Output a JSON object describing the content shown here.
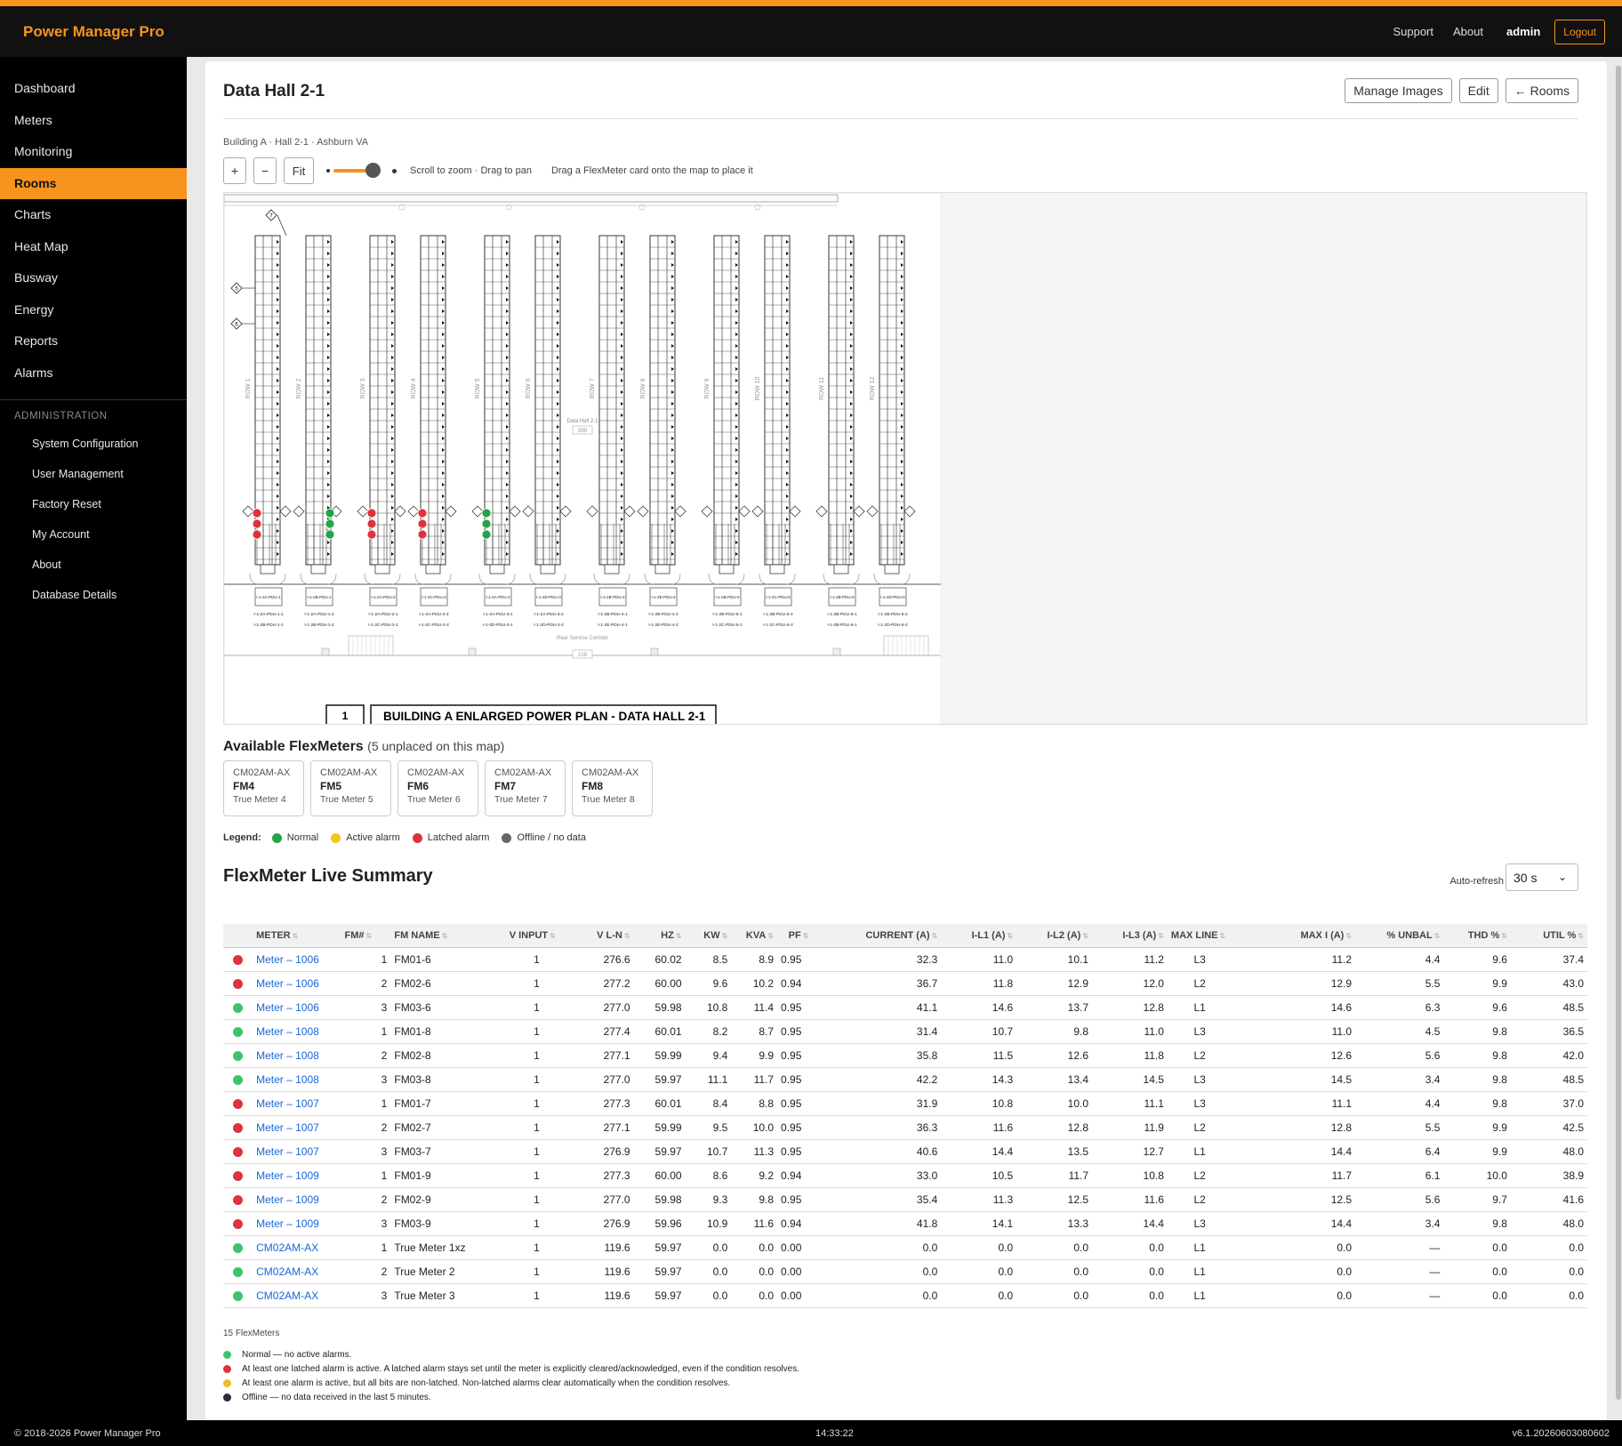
{
  "app": {
    "title": "Power Manager Pro"
  },
  "topbar": {
    "support": "Support",
    "about": "About",
    "user": "admin",
    "logout": "Logout"
  },
  "sidebar": {
    "items": [
      {
        "label": "Dashboard"
      },
      {
        "label": "Meters"
      },
      {
        "label": "Monitoring"
      },
      {
        "label": "Rooms",
        "active": true
      },
      {
        "label": "Charts"
      },
      {
        "label": "Heat Map"
      },
      {
        "label": "Busway"
      },
      {
        "label": "Energy"
      },
      {
        "label": "Reports"
      },
      {
        "label": "Alarms"
      }
    ],
    "admin_header": "ADMINISTRATION",
    "admin_items": [
      {
        "label": "System Configuration"
      },
      {
        "label": "User Management"
      },
      {
        "label": "Factory Reset"
      },
      {
        "label": "My Account"
      },
      {
        "label": "About"
      },
      {
        "label": "Database Details"
      }
    ]
  },
  "page": {
    "title": "Data Hall 2-1",
    "buttons": {
      "manage_images": "Manage Images",
      "edit": "Edit",
      "rooms": "← Rooms"
    },
    "subtitle": "Building A · Hall 2-1 · Ashburn VA",
    "toolbar": {
      "zoom_in": "+",
      "zoom_out": "−",
      "fit": "Fit",
      "zoom_level": 0.8,
      "hint1": "Scroll to zoom · Drag to pan",
      "hint2": "Drag a FlexMeter card onto the map to place it"
    }
  },
  "floorplan": {
    "title_number": "1",
    "title": "BUILDING A ENLARGED POWER PLAN - DATA HALL 2-1",
    "room_label": "Data Hall 2-1",
    "room_number": "200",
    "corridor_label": "Rear Service Corridor",
    "corridor_number": "219",
    "rows": [
      "ROW 1",
      "ROW 2",
      "ROW 3",
      "ROW 4",
      "ROW 5",
      "ROW 6",
      "ROW 7",
      "ROW 8",
      "ROW 9",
      "ROW 10",
      "ROW 11",
      "ROW 12"
    ],
    "pdus": [
      {
        "label": "I-1-2A-PDU-1",
        "feed_a": "I-1-2A-PDU-1-1",
        "feed_b": "I-1-2B-PDU-1-1"
      },
      {
        "label": "I-1-2B-PDU-1",
        "feed_a": "I-1-2A-PDU-1-2",
        "feed_b": "I-1-2B-PDU-1-2"
      },
      {
        "label": "I-1-2A-PDU-2",
        "feed_a": "I-1-2A-PDU-2-1",
        "feed_b": "I-1-2C-PDU-2-1"
      },
      {
        "label": "I-1-2C-PDU-2",
        "feed_a": "I-1-2A-PDU-2-2",
        "feed_b": "I-1-2C-PDU-2-2"
      },
      {
        "label": "I-1-2A-PDU-3",
        "feed_a": "I-1-2A-PDU-3-1",
        "feed_b": "I-1-2D-PDU-3-1"
      },
      {
        "label": "I-1-2D-PDU-3",
        "feed_a": "I-1-2A-PDU-3-2",
        "feed_b": "I-1-2D-PDU-3-2"
      },
      {
        "label": "I-1-2B-PDU-4",
        "feed_a": "I-1-2B-PDU-4-1",
        "feed_b": "I-1-2E-PDU-4-1"
      },
      {
        "label": "I-1-2E-PDU-4",
        "feed_a": "I-1-2B-PDU-4-2",
        "feed_b": "I-1-2E-PDU-4-2"
      },
      {
        "label": "I-1-2B-PDU-5",
        "feed_a": "I-1-2B-PDU-5-1",
        "feed_b": "I-1-2C-PDU-5-1"
      },
      {
        "label": "I-1-2C-PDU-5",
        "feed_a": "I-1-2B-PDU-5-2",
        "feed_b": "I-1-2C-PDU-5-2"
      },
      {
        "label": "I-1-2B-PDU-6",
        "feed_a": "I-1-2B-PDU-6-1",
        "feed_b": "I-1-2B-PDU-6-1"
      },
      {
        "label": "I-1-2D-PDU-6",
        "feed_a": "I-1-2B-PDU-6-2",
        "feed_b": "I-1-2D-PDU-6-2"
      }
    ],
    "placed_meters": [
      {
        "status": "alarm"
      },
      {
        "status": "normal"
      },
      {
        "status": "alarm"
      },
      {
        "status": "alarm"
      },
      {
        "status": "normal"
      }
    ]
  },
  "available": {
    "title": "Available FlexMeters",
    "note": "(5 unplaced on this map)",
    "cards": [
      {
        "model": "CM02AM-AX",
        "name": "FM4",
        "desc": "True Meter 4"
      },
      {
        "model": "CM02AM-AX",
        "name": "FM5",
        "desc": "True Meter 5"
      },
      {
        "model": "CM02AM-AX",
        "name": "FM6",
        "desc": "True Meter 6"
      },
      {
        "model": "CM02AM-AX",
        "name": "FM7",
        "desc": "True Meter 7"
      },
      {
        "model": "CM02AM-AX",
        "name": "FM8",
        "desc": "True Meter 8"
      }
    ]
  },
  "legend": {
    "label": "Legend:",
    "items": [
      {
        "label": "Normal",
        "color": "#22a447"
      },
      {
        "label": "Active alarm",
        "color": "#f5c518"
      },
      {
        "label": "Latched alarm",
        "color": "#e0323c"
      },
      {
        "label": "Offline / no data",
        "color": "#666666"
      }
    ]
  },
  "summary": {
    "title": "FlexMeter Live Summary",
    "autorefresh_label": "Auto-refresh",
    "autorefresh_value": "30 s",
    "columns": [
      "METER",
      "FM#",
      "FM NAME",
      "V INPUT",
      "V L-N",
      "HZ",
      "KW",
      "KVA",
      "PF",
      "CURRENT (A)",
      "I-L1 (A)",
      "I-L2 (A)",
      "I-L3 (A)",
      "MAX LINE",
      "MAX I (A)",
      "% UNBAL",
      "THD %",
      "UTIL %"
    ],
    "rows": [
      {
        "status": "red",
        "meter": "Meter – 1006",
        "fm": "1",
        "name": "FM01-6",
        "vin": "1",
        "vln": "276.6",
        "hz": "60.02",
        "kw": "8.5",
        "kva": "8.9",
        "pf": "0.95",
        "cur": "32.3",
        "l1": "11.0",
        "l2": "10.1",
        "l3": "11.2",
        "maxline": "L3",
        "maxi": "11.2",
        "unbal": "4.4",
        "thd": "9.6",
        "util": "37.4"
      },
      {
        "status": "red",
        "meter": "Meter – 1006",
        "fm": "2",
        "name": "FM02-6",
        "vin": "1",
        "vln": "277.2",
        "hz": "60.00",
        "kw": "9.6",
        "kva": "10.2",
        "pf": "0.94",
        "cur": "36.7",
        "l1": "11.8",
        "l2": "12.9",
        "l3": "12.0",
        "maxline": "L2",
        "maxi": "12.9",
        "unbal": "5.5",
        "thd": "9.9",
        "util": "43.0"
      },
      {
        "status": "green",
        "meter": "Meter – 1006",
        "fm": "3",
        "name": "FM03-6",
        "vin": "1",
        "vln": "277.0",
        "hz": "59.98",
        "kw": "10.8",
        "kva": "11.4",
        "pf": "0.95",
        "cur": "41.1",
        "l1": "14.6",
        "l2": "13.7",
        "l3": "12.8",
        "maxline": "L1",
        "maxi": "14.6",
        "unbal": "6.3",
        "thd": "9.6",
        "util": "48.5"
      },
      {
        "status": "green",
        "meter": "Meter – 1008",
        "fm": "1",
        "name": "FM01-8",
        "vin": "1",
        "vln": "277.4",
        "hz": "60.01",
        "kw": "8.2",
        "kva": "8.7",
        "pf": "0.95",
        "cur": "31.4",
        "l1": "10.7",
        "l2": "9.8",
        "l3": "11.0",
        "maxline": "L3",
        "maxi": "11.0",
        "unbal": "4.5",
        "thd": "9.8",
        "util": "36.5"
      },
      {
        "status": "green",
        "meter": "Meter – 1008",
        "fm": "2",
        "name": "FM02-8",
        "vin": "1",
        "vln": "277.1",
        "hz": "59.99",
        "kw": "9.4",
        "kva": "9.9",
        "pf": "0.95",
        "cur": "35.8",
        "l1": "11.5",
        "l2": "12.6",
        "l3": "11.8",
        "maxline": "L2",
        "maxi": "12.6",
        "unbal": "5.6",
        "thd": "9.8",
        "util": "42.0"
      },
      {
        "status": "green",
        "meter": "Meter – 1008",
        "fm": "3",
        "name": "FM03-8",
        "vin": "1",
        "vln": "277.0",
        "hz": "59.97",
        "kw": "11.1",
        "kva": "11.7",
        "pf": "0.95",
        "cur": "42.2",
        "l1": "14.3",
        "l2": "13.4",
        "l3": "14.5",
        "maxline": "L3",
        "maxi": "14.5",
        "unbal": "3.4",
        "thd": "9.8",
        "util": "48.5"
      },
      {
        "status": "red",
        "meter": "Meter – 1007",
        "fm": "1",
        "name": "FM01-7",
        "vin": "1",
        "vln": "277.3",
        "hz": "60.01",
        "kw": "8.4",
        "kva": "8.8",
        "pf": "0.95",
        "cur": "31.9",
        "l1": "10.8",
        "l2": "10.0",
        "l3": "11.1",
        "maxline": "L3",
        "maxi": "11.1",
        "unbal": "4.4",
        "thd": "9.8",
        "util": "37.0"
      },
      {
        "status": "red",
        "meter": "Meter – 1007",
        "fm": "2",
        "name": "FM02-7",
        "vin": "1",
        "vln": "277.1",
        "hz": "59.99",
        "kw": "9.5",
        "kva": "10.0",
        "pf": "0.95",
        "cur": "36.3",
        "l1": "11.6",
        "l2": "12.8",
        "l3": "11.9",
        "maxline": "L2",
        "maxi": "12.8",
        "unbal": "5.5",
        "thd": "9.9",
        "util": "42.5"
      },
      {
        "status": "red",
        "meter": "Meter – 1007",
        "fm": "3",
        "name": "FM03-7",
        "vin": "1",
        "vln": "276.9",
        "hz": "59.97",
        "kw": "10.7",
        "kva": "11.3",
        "pf": "0.95",
        "cur": "40.6",
        "l1": "14.4",
        "l2": "13.5",
        "l3": "12.7",
        "maxline": "L1",
        "maxi": "14.4",
        "unbal": "6.4",
        "thd": "9.9",
        "util": "48.0"
      },
      {
        "status": "red",
        "meter": "Meter – 1009",
        "fm": "1",
        "name": "FM01-9",
        "vin": "1",
        "vln": "277.3",
        "hz": "60.00",
        "kw": "8.6",
        "kva": "9.2",
        "pf": "0.94",
        "cur": "33.0",
        "l1": "10.5",
        "l2": "11.7",
        "l3": "10.8",
        "maxline": "L2",
        "maxi": "11.7",
        "unbal": "6.1",
        "thd": "10.0",
        "util": "38.9"
      },
      {
        "status": "red",
        "meter": "Meter – 1009",
        "fm": "2",
        "name": "FM02-9",
        "vin": "1",
        "vln": "277.0",
        "hz": "59.98",
        "kw": "9.3",
        "kva": "9.8",
        "pf": "0.95",
        "cur": "35.4",
        "l1": "11.3",
        "l2": "12.5",
        "l3": "11.6",
        "maxline": "L2",
        "maxi": "12.5",
        "unbal": "5.6",
        "thd": "9.7",
        "util": "41.6"
      },
      {
        "status": "red",
        "meter": "Meter – 1009",
        "fm": "3",
        "name": "FM03-9",
        "vin": "1",
        "vln": "276.9",
        "hz": "59.96",
        "kw": "10.9",
        "kva": "11.6",
        "pf": "0.94",
        "cur": "41.8",
        "l1": "14.1",
        "l2": "13.3",
        "l3": "14.4",
        "maxline": "L3",
        "maxi": "14.4",
        "unbal": "3.4",
        "thd": "9.8",
        "util": "48.0"
      },
      {
        "status": "green",
        "meter": "CM02AM-AX",
        "fm": "1",
        "name": "True Meter 1xz",
        "vin": "1",
        "vln": "119.6",
        "hz": "59.97",
        "kw": "0.0",
        "kva": "0.0",
        "pf": "0.00",
        "cur": "0.0",
        "l1": "0.0",
        "l2": "0.0",
        "l3": "0.0",
        "maxline": "L1",
        "maxi": "0.0",
        "unbal": "—",
        "thd": "0.0",
        "util": "0.0"
      },
      {
        "status": "green",
        "meter": "CM02AM-AX",
        "fm": "2",
        "name": "True Meter 2",
        "vin": "1",
        "vln": "119.6",
        "hz": "59.97",
        "kw": "0.0",
        "kva": "0.0",
        "pf": "0.00",
        "cur": "0.0",
        "l1": "0.0",
        "l2": "0.0",
        "l3": "0.0",
        "maxline": "L1",
        "maxi": "0.0",
        "unbal": "—",
        "thd": "0.0",
        "util": "0.0"
      },
      {
        "status": "green",
        "meter": "CM02AM-AX",
        "fm": "3",
        "name": "True Meter 3",
        "vin": "1",
        "vln": "119.6",
        "hz": "59.97",
        "kw": "0.0",
        "kva": "0.0",
        "pf": "0.00",
        "cur": "0.0",
        "l1": "0.0",
        "l2": "0.0",
        "l3": "0.0",
        "maxline": "L1",
        "maxi": "0.0",
        "unbal": "—",
        "thd": "0.0",
        "util": "0.0"
      }
    ],
    "count": "15 FlexMeters",
    "notes": [
      {
        "color": "#3dc46a",
        "text": "Normal — no active alarms."
      },
      {
        "color": "#e0323c",
        "text": "At least one latched alarm is active. A latched alarm stays set until the meter is explicitly cleared/acknowledged, even if the condition resolves."
      },
      {
        "color": "#f5b82e",
        "text": "At least one alarm is active, but all bits are non-latched. Non-latched alarms clear automatically when the condition resolves."
      },
      {
        "color": "#2a2a3a",
        "text": "Offline — no data received in the last 5 minutes."
      }
    ]
  },
  "footer": {
    "copyright": "© 2018-2026 Power Manager Pro",
    "time": "14:33:22",
    "version": "v6.1.20260603080602"
  }
}
